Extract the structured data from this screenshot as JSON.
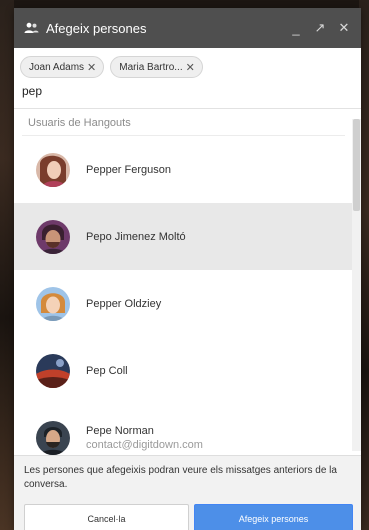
{
  "window": {
    "title": "Afegeix persones",
    "icon": "add-people-icon",
    "controls": {
      "minimize": "_",
      "popout": "↗",
      "close": "✕"
    }
  },
  "chips": [
    {
      "label": "Joan Adams"
    },
    {
      "label": "Maria Bartro..."
    }
  ],
  "chip_remove": "✕",
  "search": {
    "value": "pep"
  },
  "section": {
    "label": "Usuaris de Hangouts"
  },
  "results": [
    {
      "name": "Pepper Ferguson",
      "sub": "",
      "highlighted": false
    },
    {
      "name": "Pepo Jimenez Moltó",
      "sub": "",
      "highlighted": true
    },
    {
      "name": "Pepper Oldziey",
      "sub": "",
      "highlighted": false
    },
    {
      "name": "Pep Coll",
      "sub": "",
      "highlighted": false
    },
    {
      "name": "Pepe Norman",
      "sub": "contact@digitdown.com",
      "highlighted": false
    }
  ],
  "footer": {
    "notice": "Les persones que afegeixis podran veure els missatges anteriors de la conversa.",
    "cancel_label": "Cancel·la",
    "add_label": "Afegeix persones"
  },
  "colors": {
    "titlebar": "#4f4f4f",
    "accent": "#4d8fe8",
    "highlight_row": "#e8e8e8"
  }
}
